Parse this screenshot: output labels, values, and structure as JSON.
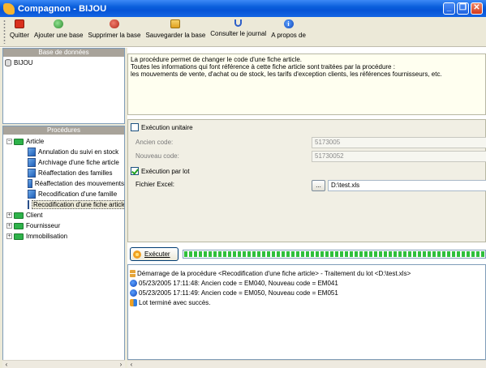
{
  "window": {
    "title": "Compagnon - BIJOU",
    "controls": [
      "_",
      "❐",
      "✕"
    ]
  },
  "toolbar": {
    "buttons": [
      {
        "label": "Quitter",
        "icon": "quit-icon"
      },
      {
        "label": "Ajouter une base",
        "icon": "add-database-icon"
      },
      {
        "label": "Supprimer la base",
        "icon": "delete-database-icon"
      },
      {
        "label": "Sauvegarder la base",
        "icon": "save-database-icon"
      },
      {
        "label": "Consulter le journal",
        "icon": "journal-icon"
      },
      {
        "label": "A propos de",
        "icon": "about-icon"
      }
    ]
  },
  "databases": {
    "header": "Base de données",
    "items": [
      "BIJOU"
    ]
  },
  "procedures": {
    "header": "Procédures",
    "tree": [
      {
        "label": "Article",
        "expanded": true,
        "children": [
          "Annulation du suivi en stock",
          "Archivage d'une fiche article",
          "Réaffectation des familles",
          "Réaffectation des mouvements",
          "Recodification d'une famille",
          "Recodification d'une fiche article"
        ],
        "selected": 5
      },
      {
        "label": "Client",
        "expanded": false
      },
      {
        "label": "Fournisseur",
        "expanded": false
      },
      {
        "label": "Immobilisation",
        "expanded": false
      }
    ]
  },
  "description": {
    "lines": [
      "La procédure permet de changer le code d'une fiche article.",
      "Toutes les informations qui font référence à cette fiche article sont traitées par la procédure :",
      "les mouvements de vente, d'achat ou de stock, les tarifs d'exception clients, les références fournisseurs, etc."
    ]
  },
  "params": {
    "unit_label": "Exécution unitaire",
    "unit_checked": false,
    "old_code_label": "Ancien code:",
    "old_code_value": "5173005",
    "new_code_label": "Nouveau code:",
    "new_code_value": "51730052",
    "batch_label": "Exécution par lot",
    "batch_checked": true,
    "excel_label": "Fichier Excel:",
    "browse_label": "...",
    "excel_value": "D:\\test.xls"
  },
  "execute": {
    "label": "Exécuter",
    "progress": 1.0
  },
  "log": [
    {
      "icon": "hourglass-icon",
      "text": "Démarrage de la procédure <Recodification d'une fiche article> - Traitement du lot <D:\\test.xls>"
    },
    {
      "icon": "info-icon",
      "text": "05/23/2005 17:11:48: Ancien code = EM040, Nouveau code = EM041"
    },
    {
      "icon": "info-icon",
      "text": "05/23/2005 17:11:49: Ancien code = EM050, Nouveau code = EM051"
    },
    {
      "icon": "done-icon",
      "text": "Lot terminé avec succès."
    }
  ],
  "scroll": {
    "left": "‹",
    "right": "›"
  }
}
